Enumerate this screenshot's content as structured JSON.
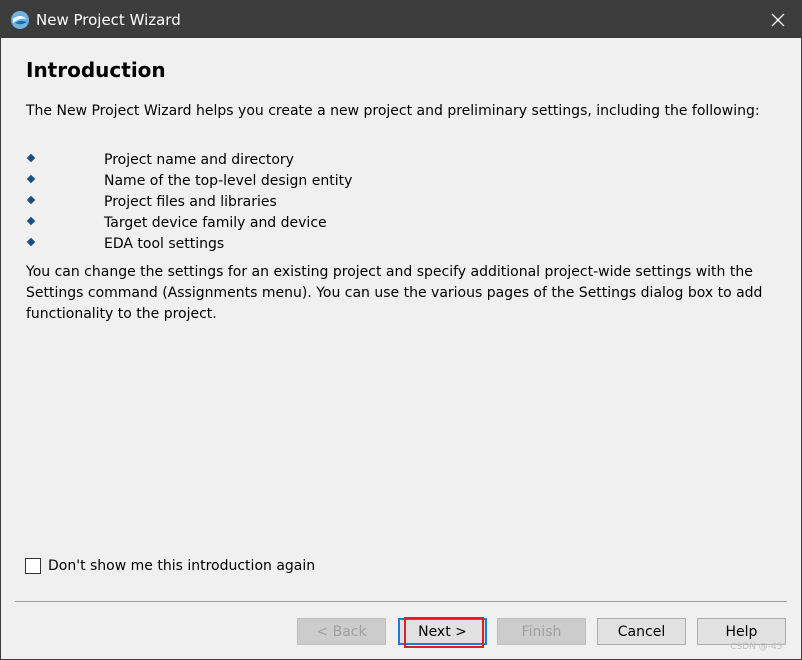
{
  "window": {
    "title": "New Project Wizard",
    "app_icon": "quartus-app-icon",
    "close_glyph": "✕"
  },
  "page": {
    "heading": "Introduction",
    "intro": "The New Project Wizard helps you create a new project and preliminary settings, including the following:",
    "bullets": [
      "Project name and directory",
      "Name of the top-level design entity",
      "Project files and libraries",
      "Target device family and device",
      "EDA tool settings"
    ],
    "outro": "You can change the settings for an existing project and specify additional project-wide settings with the Settings command (Assignments menu). You can use the various pages of the Settings dialog box to add functionality to the project."
  },
  "checkbox": {
    "label": "Don't show me this introduction again",
    "checked": false
  },
  "buttons": {
    "back": "< Back",
    "next": "Next >",
    "finish": "Finish",
    "cancel": "Cancel",
    "help": "Help"
  },
  "watermark": "CSDN @-45°",
  "colors": {
    "titlebar": "#3c3c3c",
    "bullet": "#1b4f82",
    "highlight": "#e0201e",
    "focus": "#1e78d7"
  }
}
